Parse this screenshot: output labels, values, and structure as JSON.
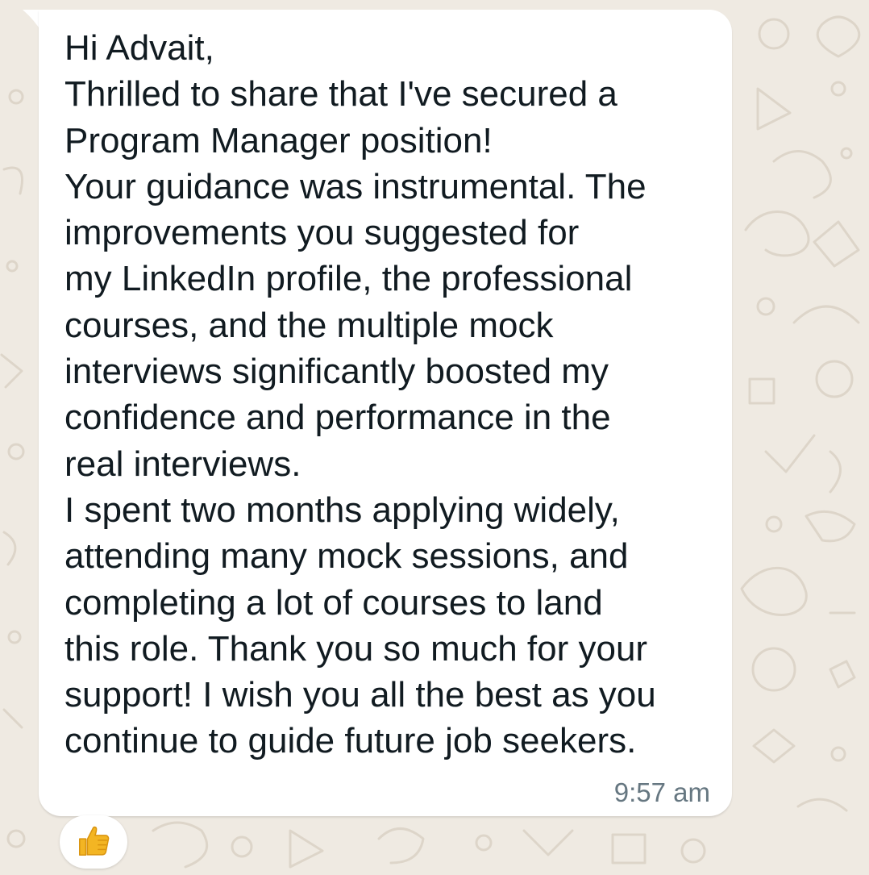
{
  "chat": {
    "message": {
      "lines": [
        "Hi Advait,",
        "Thrilled to share that I've secured a",
        "Program Manager position!",
        "Your guidance was instrumental. The",
        "improvements you suggested for",
        "my LinkedIn profile, the professional",
        "courses, and the multiple mock",
        "interviews significantly boosted my",
        "confidence and performance in the",
        "real interviews.",
        "I spent two months applying widely,",
        "attending many mock sessions, and",
        "completing a lot of courses to land",
        "this role. Thank you so much for your",
        "support! I wish you all the best as you",
        "continue to guide future job seekers."
      ],
      "time": "9:57 am",
      "reaction": {
        "icon": "thumbs-up-icon",
        "color": "#f3b523"
      }
    },
    "background_color": "#efeae2",
    "bubble_color": "#ffffff"
  }
}
